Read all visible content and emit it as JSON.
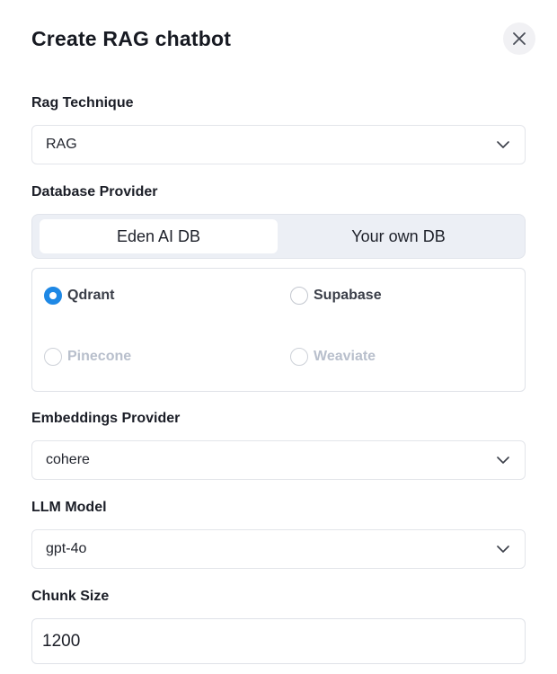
{
  "dialog": {
    "title": "Create RAG chatbot"
  },
  "rag_technique": {
    "label": "Rag Technique",
    "value": "RAG"
  },
  "database_provider": {
    "label": "Database Provider",
    "tabs": [
      {
        "label": "Eden AI DB",
        "active": true
      },
      {
        "label": "Your own DB",
        "active": false
      }
    ],
    "options": [
      {
        "label": "Qdrant",
        "checked": true,
        "disabled": false
      },
      {
        "label": "Supabase",
        "checked": false,
        "disabled": false
      },
      {
        "label": "Pinecone",
        "checked": false,
        "disabled": true
      },
      {
        "label": "Weaviate",
        "checked": false,
        "disabled": true
      }
    ]
  },
  "embeddings_provider": {
    "label": "Embeddings Provider",
    "value": "cohere"
  },
  "llm_model": {
    "label": "LLM Model",
    "value": "gpt-4o"
  },
  "chunk_size": {
    "label": "Chunk Size",
    "value": "1200"
  },
  "icons": {
    "close": "close-icon",
    "dropdown": "chevron-down-icon"
  },
  "colors": {
    "accent": "#1e88e5",
    "segment_bg": "#eceff5"
  }
}
